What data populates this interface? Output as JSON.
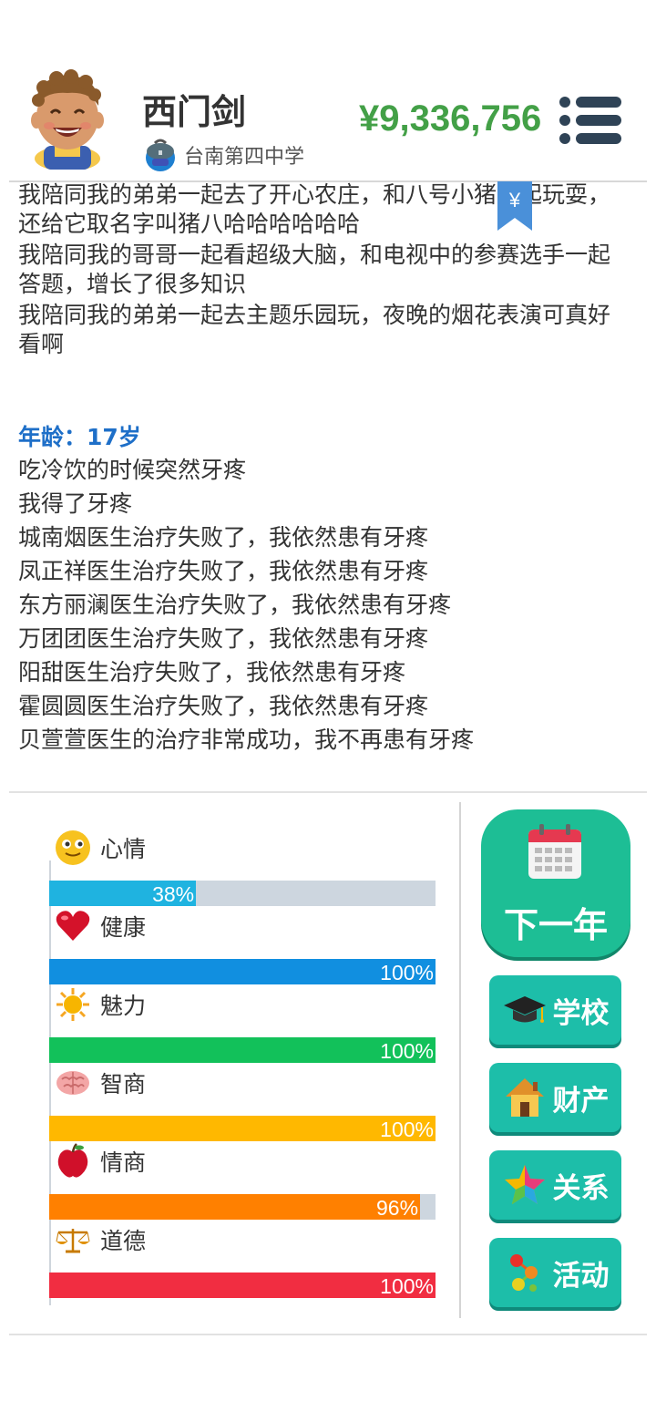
{
  "header": {
    "name": "西门剑",
    "school": "台南第四中学",
    "money": "¥9,336,756",
    "money_symbol": "¥"
  },
  "log": {
    "previous_lines": [
      "我陪同我的弟弟一起去了开心农庄，和八号小猪一起玩耍，还给它取名字叫猪八哈哈哈哈哈哈",
      "我陪同我的哥哥一起看超级大脑，和电视中的参赛选手一起答题，增长了很多知识",
      "我陪同我的弟弟一起去主题乐园玩，夜晚的烟花表演可真好看啊"
    ],
    "age_heading": "年龄：17岁",
    "events": [
      "吃冷饮的时候突然牙疼",
      "我得了牙疼",
      "城南烟医生治疗失败了，我依然患有牙疼",
      "凤正祥医生治疗失败了，我依然患有牙疼",
      "东方丽澜医生治疗失败了，我依然患有牙疼",
      "万团团医生治疗失败了，我依然患有牙疼",
      "阳甜医生治疗失败了，我依然患有牙疼",
      "霍圆圆医生治疗失败了，我依然患有牙疼",
      "贝萱萱医生的治疗非常成功，我不再患有牙疼"
    ]
  },
  "stats": [
    {
      "label": "心情",
      "value": "38%",
      "percent": 38,
      "color": "#1fb3e0",
      "icon": "smiley-icon"
    },
    {
      "label": "健康",
      "value": "100%",
      "percent": 100,
      "color": "#118fe0",
      "icon": "heart-icon"
    },
    {
      "label": "魅力",
      "value": "100%",
      "percent": 100,
      "color": "#12c15a",
      "icon": "sun-icon"
    },
    {
      "label": "智商",
      "value": "100%",
      "percent": 100,
      "color": "#ffb800",
      "icon": "brain-icon"
    },
    {
      "label": "情商",
      "value": "96%",
      "percent": 96,
      "color": "#ff8000",
      "icon": "apple-icon"
    },
    {
      "label": "道德",
      "value": "100%",
      "percent": 100,
      "color": "#f12d41",
      "icon": "scales-icon"
    }
  ],
  "buttons": {
    "next_year": "下一年",
    "school": "学校",
    "property": "财产",
    "relations": "关系",
    "activities": "活动"
  }
}
